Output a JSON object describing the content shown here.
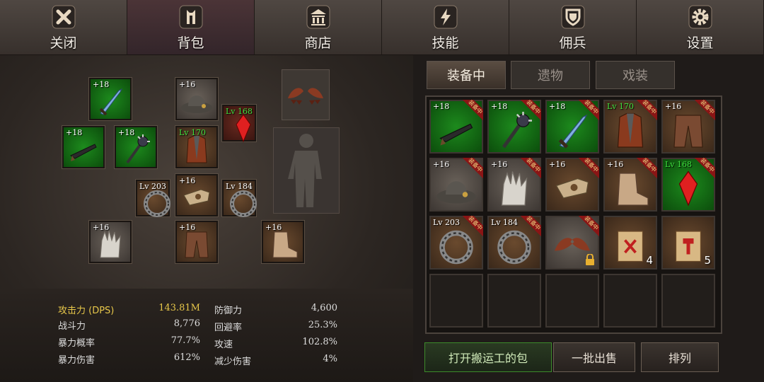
{
  "topbar": {
    "tabs": [
      {
        "label": "关闭",
        "icon": "close-icon"
      },
      {
        "label": "背包",
        "icon": "bag-icon"
      },
      {
        "label": "商店",
        "icon": "shop-icon"
      },
      {
        "label": "技能",
        "icon": "lightning-icon"
      },
      {
        "label": "佣兵",
        "icon": "shield-icon"
      },
      {
        "label": "设置",
        "icon": "gear-icon"
      }
    ]
  },
  "equipment": {
    "slots": [
      {
        "label": "+18",
        "item": "sword"
      },
      {
        "label": "+16",
        "item": "hat"
      },
      {
        "label": "Lv 168",
        "item": "red-gem"
      },
      {
        "label": "+18",
        "item": "gun"
      },
      {
        "label": "+18",
        "item": "mace"
      },
      {
        "label": "Lv 170",
        "item": "armor"
      },
      {
        "label": "Lv 203",
        "item": "ring"
      },
      {
        "label": "+16",
        "item": "gauntlet"
      },
      {
        "label": "Lv 184",
        "item": "ring"
      },
      {
        "label": "+16",
        "item": "glove"
      },
      {
        "label": "+16",
        "item": "pants"
      },
      {
        "label": "+16",
        "item": "boots"
      }
    ]
  },
  "stats": {
    "rows": [
      {
        "label": "攻击力 (DPS)",
        "value": "143.81M"
      },
      {
        "label": "战斗力",
        "value": "8,776"
      },
      {
        "label": "暴力概率",
        "value": "77.7%"
      },
      {
        "label": "暴力伤害",
        "value": "612%"
      },
      {
        "label": "防御力",
        "value": "4,600"
      },
      {
        "label": "回避率",
        "value": "25.3%"
      },
      {
        "label": "攻速",
        "value": "102.8%"
      },
      {
        "label": "减少伤害",
        "value": "4%"
      }
    ],
    "highlight_color": "#e8c84a"
  },
  "inventory": {
    "tabs": [
      "装备中",
      "遗物",
      "戏装"
    ],
    "equipped_tag": "装备中",
    "cells": [
      {
        "label": "+18",
        "item": "gun",
        "equipped": true
      },
      {
        "label": "+18",
        "item": "mace",
        "equipped": true
      },
      {
        "label": "+18",
        "item": "sword",
        "equipped": true
      },
      {
        "label": "Lv 170",
        "item": "armor",
        "equipped": true
      },
      {
        "label": "+16",
        "item": "pants",
        "equipped": true
      },
      {
        "label": "+16",
        "item": "hat",
        "equipped": true
      },
      {
        "label": "+16",
        "item": "glove",
        "equipped": true
      },
      {
        "label": "+16",
        "item": "gauntlet",
        "equipped": true
      },
      {
        "label": "+16",
        "item": "boots",
        "equipped": true
      },
      {
        "label": "Lv 168",
        "item": "red-gem",
        "equipped": true
      },
      {
        "label": "Lv 203",
        "item": "ring",
        "equipped": true
      },
      {
        "label": "Lv 184",
        "item": "ring",
        "equipped": true
      },
      {
        "label": "",
        "item": "wings",
        "equipped": true,
        "locked": true
      },
      {
        "label": "",
        "item": "scroll",
        "count": "4"
      },
      {
        "label": "",
        "item": "scroll-red",
        "count": "5"
      }
    ]
  },
  "buttons": {
    "open_porter_bag": "打开搬运工的包",
    "bulk_sell": "一批出售",
    "sort": "排列"
  }
}
